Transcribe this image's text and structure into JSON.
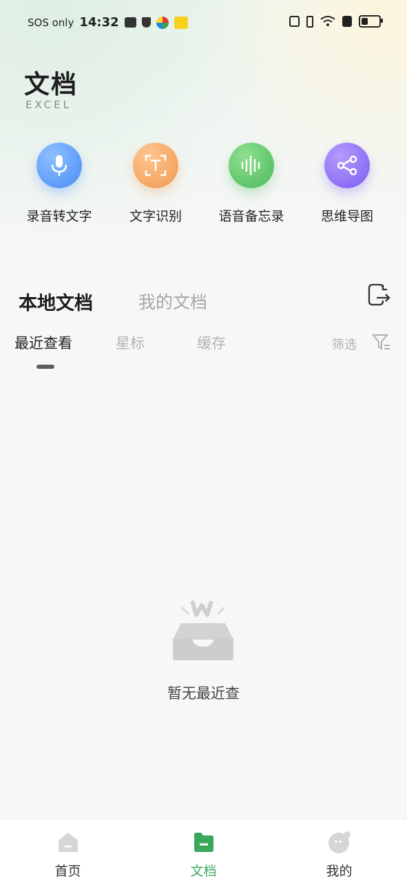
{
  "status": {
    "carrier": "SOS only",
    "time": "14:32"
  },
  "header": {
    "title": "文档",
    "subtitle": "EXCEL"
  },
  "tools": [
    {
      "label": "录音转文字",
      "icon": "microphone-icon",
      "color": "#4f94ff"
    },
    {
      "label": "文字识别",
      "icon": "text-scan-icon",
      "color": "#f5a05a"
    },
    {
      "label": "语音备忘录",
      "icon": "sound-wave-icon",
      "color": "#5cc464"
    },
    {
      "label": "思维导图",
      "icon": "mind-map-icon",
      "color": "#8a6cf5"
    }
  ],
  "tabs": {
    "local": "本地文档",
    "mine": "我的文档"
  },
  "subtabs": {
    "recent": "最近查看",
    "starred": "星标",
    "cache": "缓存",
    "filter": "筛选"
  },
  "empty": {
    "message": "暂无最近查"
  },
  "nav": {
    "home": "首页",
    "docs": "文档",
    "mine": "我的"
  },
  "colors": {
    "accent_green": "#3aa85c"
  }
}
